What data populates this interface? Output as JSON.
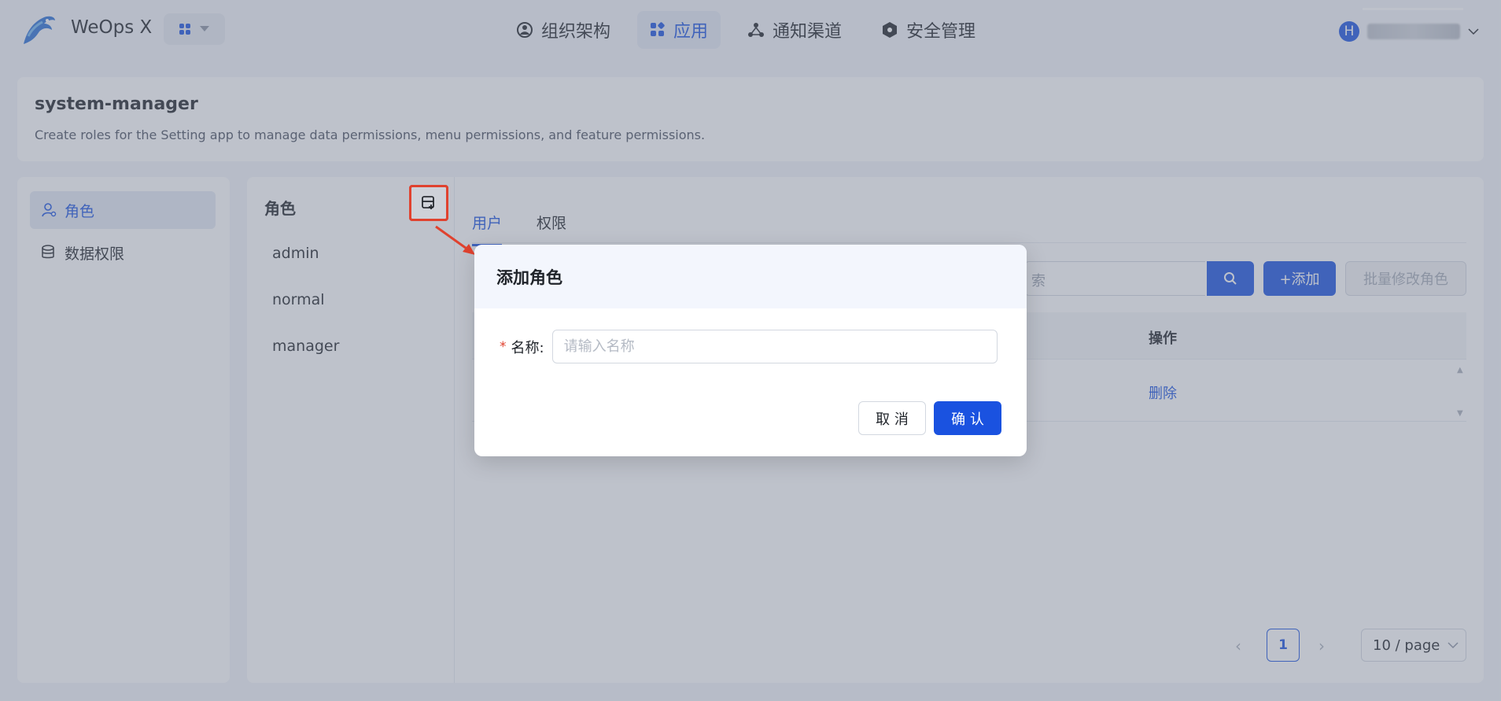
{
  "header": {
    "app_name": "WeOps X",
    "nav": [
      {
        "label": "组织架构",
        "icon": "org-icon"
      },
      {
        "label": "应用",
        "icon": "apps-icon"
      },
      {
        "label": "通知渠道",
        "icon": "notify-icon"
      },
      {
        "label": "安全管理",
        "icon": "security-icon"
      }
    ],
    "user_avatar": "H",
    "accent": "#1a52e0"
  },
  "page": {
    "title": "system-manager",
    "description": "Create roles for the Setting app to manage data permissions, menu permissions, and feature permissions."
  },
  "sidebar": {
    "items": [
      {
        "label": "角色",
        "icon": "user-role-icon"
      },
      {
        "label": "数据权限",
        "icon": "database-icon"
      }
    ]
  },
  "roles": {
    "title": "角色",
    "items": [
      "admin",
      "normal",
      "manager"
    ]
  },
  "tabs": [
    {
      "label": "用户"
    },
    {
      "label": "权限"
    }
  ],
  "toolbar": {
    "search_placeholder_tail": "索",
    "add_label": "+添加",
    "batch_label": "批量修改角色"
  },
  "table": {
    "op_header": "操作",
    "rows": [
      {
        "action": "删除"
      }
    ]
  },
  "pagination": {
    "current_page": "1",
    "page_size": "10 / page"
  },
  "modal": {
    "title": "添加角色",
    "field_label": "名称:",
    "field_placeholder": "请输入名称",
    "cancel_label": "取 消",
    "ok_label": "确 认",
    "annotation_color": "#e0422f"
  }
}
